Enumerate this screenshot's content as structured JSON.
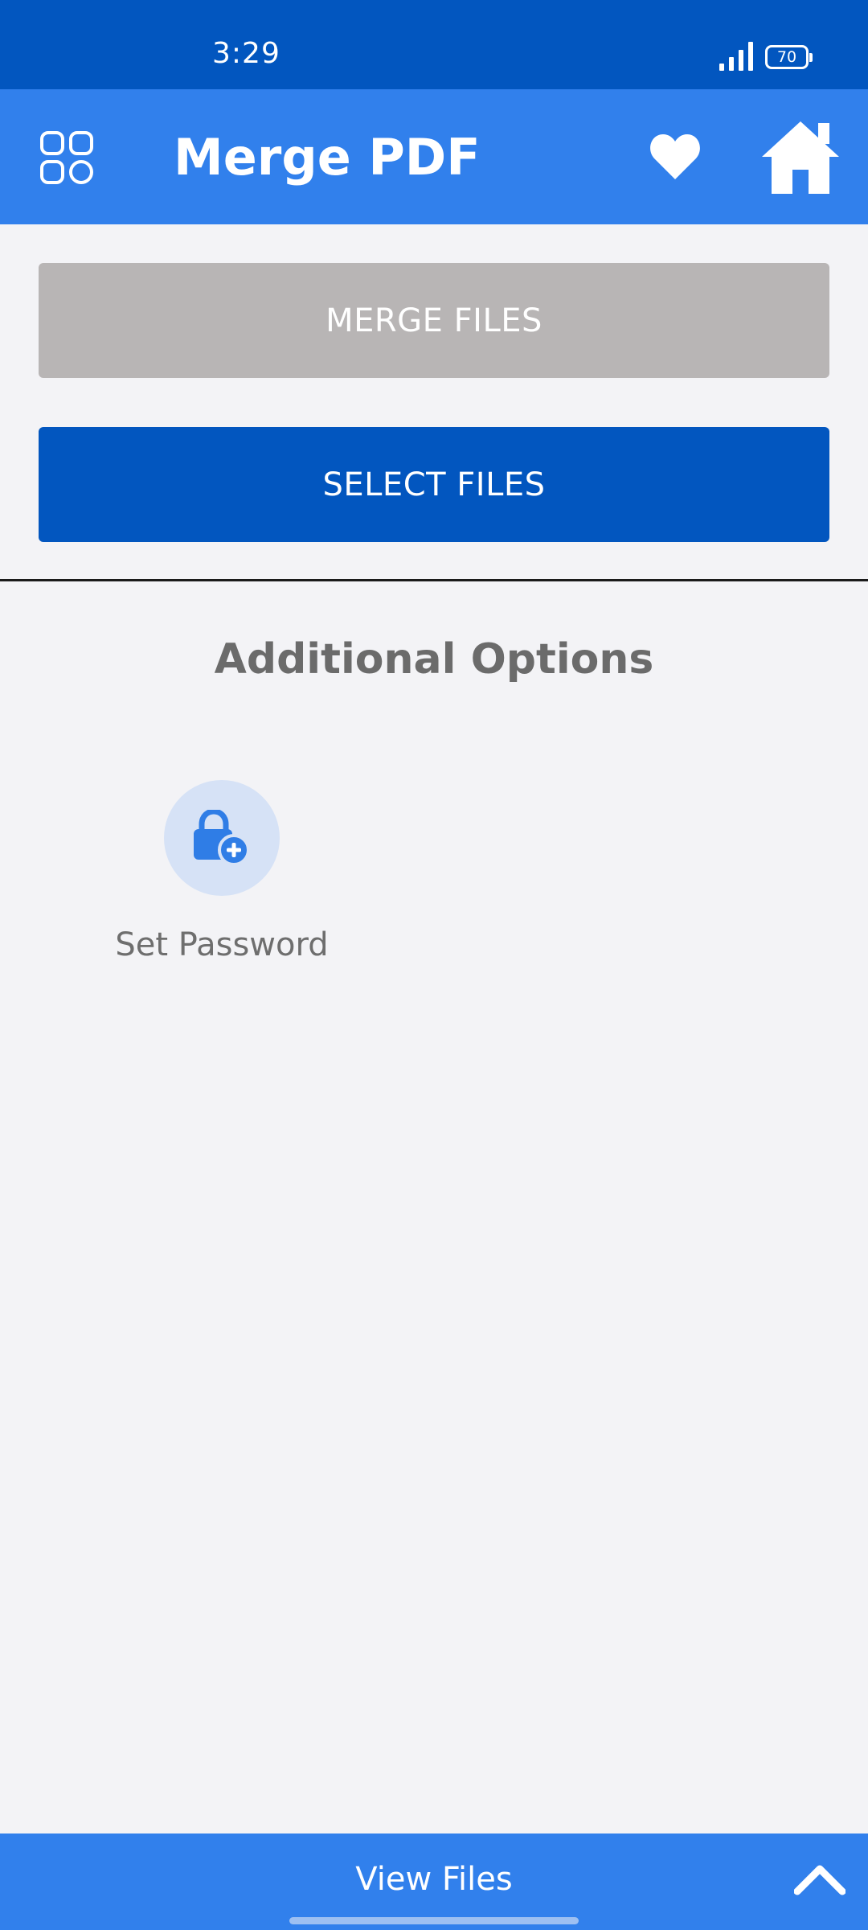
{
  "status_bar": {
    "time": "3:29",
    "battery_level": "70",
    "signal_icon": "signal-bars-icon"
  },
  "app_bar": {
    "title": "Merge PDF",
    "menu_icon": "grid-menu-icon",
    "favorite_icon": "heart-icon",
    "home_icon": "home-icon"
  },
  "actions": {
    "merge_label": "MERGE FILES",
    "select_label": "SELECT FILES"
  },
  "options": {
    "title": "Additional Options",
    "items": [
      {
        "label": "Set Password",
        "icon": "lock-plus-icon"
      }
    ]
  },
  "bottom_bar": {
    "label": "View Files",
    "icon": "chevron-up-icon"
  },
  "colors": {
    "status_bar": "#0256bf",
    "app_bar": "#3180ec",
    "primary_button": "#0256bf",
    "disabled_button": "#b8b5b5",
    "background": "#f3f3f6",
    "option_circle": "#d6e2f6"
  }
}
